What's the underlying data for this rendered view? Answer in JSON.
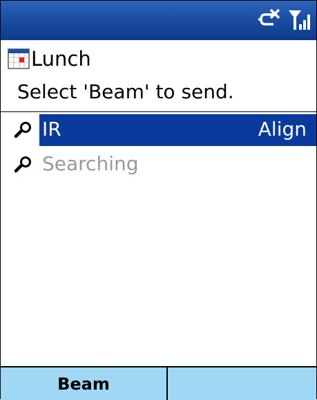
{
  "status_bar": {
    "icons": [
      "connectivity-off-icon",
      "signal-strength-icon"
    ]
  },
  "title": {
    "icon": "calendar-icon",
    "text": "Lunch"
  },
  "instruction": "Select 'Beam' to send.",
  "devices": [
    {
      "icon": "magnifier-icon",
      "name": "IR",
      "status": "Align",
      "selected": true
    },
    {
      "icon": "magnifier-icon",
      "name": "Searching",
      "status": "",
      "selected": false
    }
  ],
  "softkeys": {
    "left": "Beam",
    "right": ""
  },
  "colors": {
    "status_bar": "#1c4fa3",
    "selection": "#0a3b9c",
    "softkey_bar": "#9fd7f5",
    "disabled_text": "#9a9a9a"
  }
}
